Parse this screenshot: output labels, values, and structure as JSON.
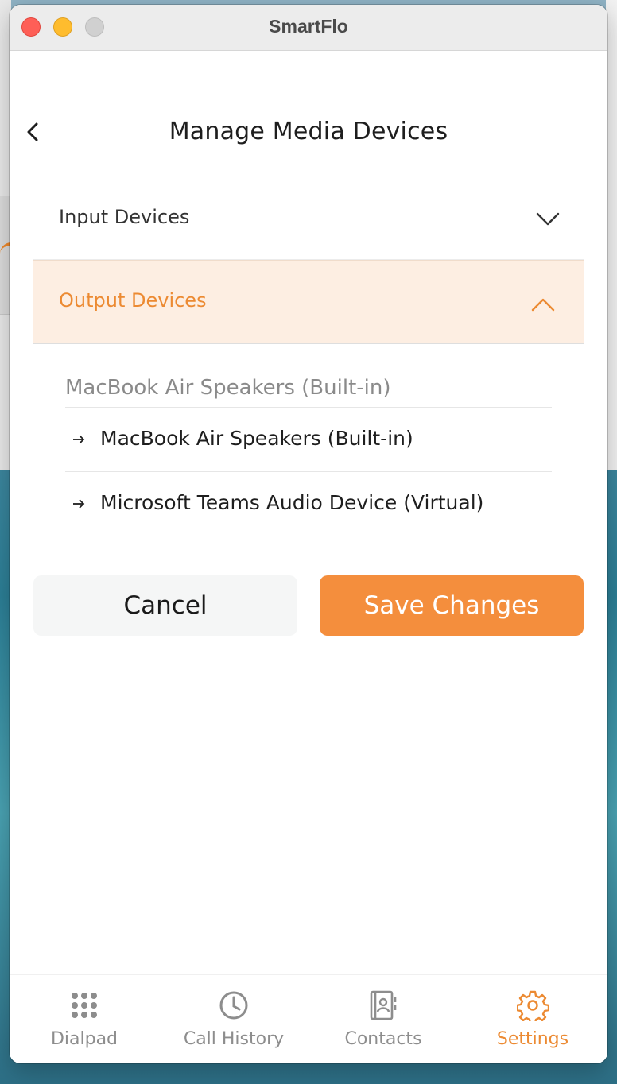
{
  "window": {
    "title": "SmartFlo"
  },
  "header": {
    "title": "Manage Media Devices"
  },
  "sections": {
    "input": {
      "label": "Input Devices",
      "expanded": false
    },
    "output": {
      "label": "Output Devices",
      "expanded": true
    }
  },
  "output_devices": {
    "selected": "MacBook Air Speakers (Built-in)",
    "options": [
      {
        "label": "MacBook Air Speakers (Built-in)"
      },
      {
        "label": "Microsoft Teams Audio Device (Virtual)"
      }
    ]
  },
  "actions": {
    "cancel_label": "Cancel",
    "save_label": "Save Changes"
  },
  "tabs": [
    {
      "label": "Dialpad",
      "icon": "dialpad-icon",
      "active": false
    },
    {
      "label": "Call History",
      "icon": "clock-icon",
      "active": false
    },
    {
      "label": "Contacts",
      "icon": "contacts-icon",
      "active": false
    },
    {
      "label": "Settings",
      "icon": "gear-icon",
      "active": true
    }
  ],
  "colors": {
    "accent": "#f48e3d",
    "accent_text": "#ec8a32",
    "active_section_bg": "#fdeee2"
  }
}
